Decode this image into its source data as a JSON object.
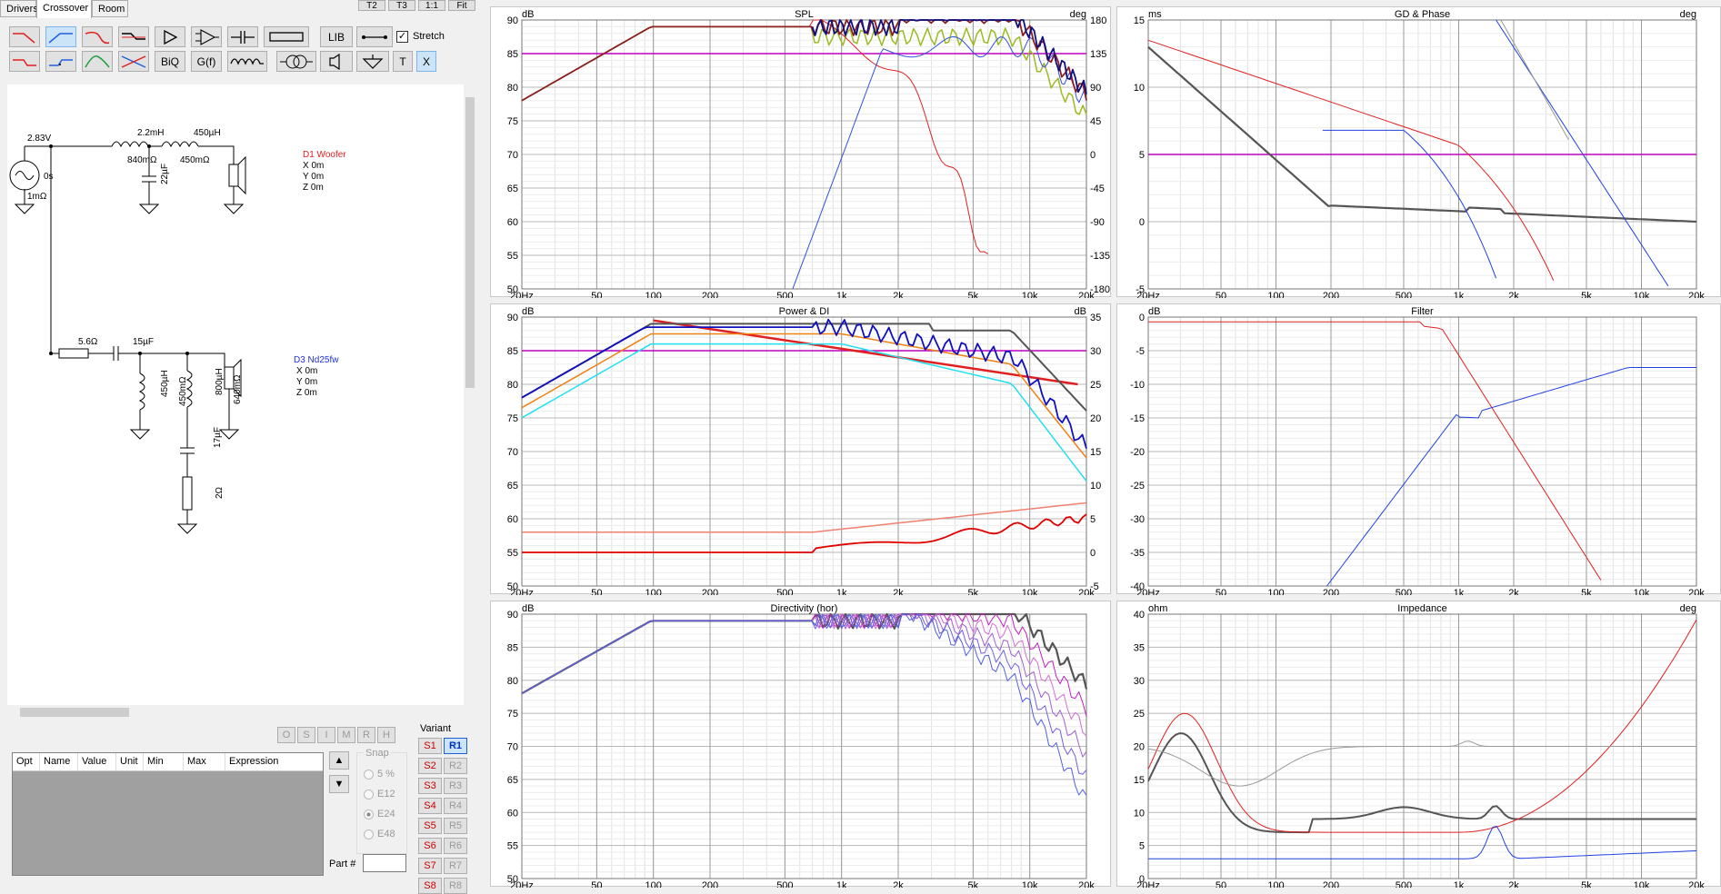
{
  "tabs": [
    "Drivers",
    "Crossover",
    "Room"
  ],
  "top_buttons": [
    "T2",
    "T3",
    "1:1",
    "Fit"
  ],
  "toolbar": {
    "row1": [
      "lowpass-1",
      "highpass-1",
      "lowpass-2",
      "notch",
      "buffer",
      "opamp",
      "capacitor",
      "resistor",
      "LIB",
      "wire"
    ],
    "stretch_label": "Stretch",
    "row2": [
      "lowpass-3",
      "highpass-3",
      "bandpass",
      "allpass",
      "BiQ",
      "G(f)",
      "inductor",
      "transformer",
      "speaker",
      "ground",
      "T",
      "X"
    ]
  },
  "schematic": {
    "source_voltage": "2.83V",
    "source_delay": "0s",
    "source_r": "1mΩ",
    "l1": "2.2mH",
    "l1_r": "840mΩ",
    "l2": "450µH",
    "l2_r": "450mΩ",
    "c1": "22µF",
    "d1_name": "D1 Woofer",
    "d1_x": "X 0m",
    "d1_y": "Y 0m",
    "d1_z": "Z 0m",
    "r1": "5.6Ω",
    "c2": "15µF",
    "l3": "450µH",
    "l3_r": "450mΩ",
    "l4": "800µH",
    "l4_r": "640mΩ",
    "c3": "17µF",
    "r2": "2Ω",
    "d3_name": "D3 Nd25fw",
    "d3_x": "X 0m",
    "d3_y": "Y 0m",
    "d3_z": "Z 0m"
  },
  "opt_buttons": [
    "O",
    "S",
    "I",
    "M",
    "R",
    "H"
  ],
  "table_headers": [
    "Opt",
    "Name",
    "Value",
    "Unit",
    "Min",
    "Max",
    "Expression"
  ],
  "snap": {
    "label": "Snap",
    "options": [
      "5 %",
      "E12",
      "E24",
      "E48"
    ],
    "selected": "E24"
  },
  "part_label": "Part #",
  "variant": {
    "label": "Variant",
    "s": [
      "S1",
      "S2",
      "S3",
      "S4",
      "S5",
      "S6",
      "S7",
      "S8"
    ],
    "r": [
      "R1",
      "R2",
      "R3",
      "R4",
      "R5",
      "R6",
      "R7",
      "R8"
    ]
  },
  "freq_ticks": [
    "20Hz",
    "50",
    "100",
    "200",
    "500",
    "1k",
    "2k",
    "5k",
    "10k",
    "20k"
  ],
  "panels": {
    "spl": {
      "title": "SPL",
      "left_unit": "dB",
      "right_unit": "deg",
      "left_ticks": [
        "90",
        "85",
        "80",
        "75",
        "70",
        "65",
        "60",
        "55",
        "50"
      ],
      "right_ticks": [
        "180",
        "135",
        "90",
        "45",
        "0",
        "-45",
        "-90",
        "-135",
        "-180"
      ]
    },
    "gd": {
      "title": "GD & Phase",
      "left_unit": "ms",
      "right_unit": "deg",
      "left_ticks": [
        "15",
        "10",
        "5",
        "0",
        "-5"
      ]
    },
    "power": {
      "title": "Power & DI",
      "left_unit": "dB",
      "right_unit": "dB",
      "left_ticks": [
        "90",
        "85",
        "80",
        "75",
        "70",
        "65",
        "60",
        "55",
        "50"
      ],
      "right_ticks": [
        "35",
        "30",
        "25",
        "20",
        "15",
        "10",
        "5",
        "0",
        "-5"
      ]
    },
    "filter": {
      "title": "Filter",
      "left_unit": "dB",
      "left_ticks": [
        "0",
        "-5",
        "-10",
        "-15",
        "-20",
        "-25",
        "-30",
        "-35",
        "-40"
      ]
    },
    "dir": {
      "title": "Directivity (hor)",
      "left_unit": "dB",
      "left_ticks": [
        "90",
        "85",
        "80",
        "75",
        "70",
        "65",
        "60",
        "55",
        "50"
      ]
    },
    "imp": {
      "title": "Impedance",
      "left_unit": "ohm",
      "right_unit": "deg",
      "left_ticks": [
        "40",
        "35",
        "30",
        "25",
        "20",
        "15",
        "10",
        "5",
        "0"
      ]
    }
  },
  "colors": {
    "woofer": "#e02020",
    "tweeter": "#2030e0",
    "sum": "#101080",
    "target": "#c000c0"
  }
}
